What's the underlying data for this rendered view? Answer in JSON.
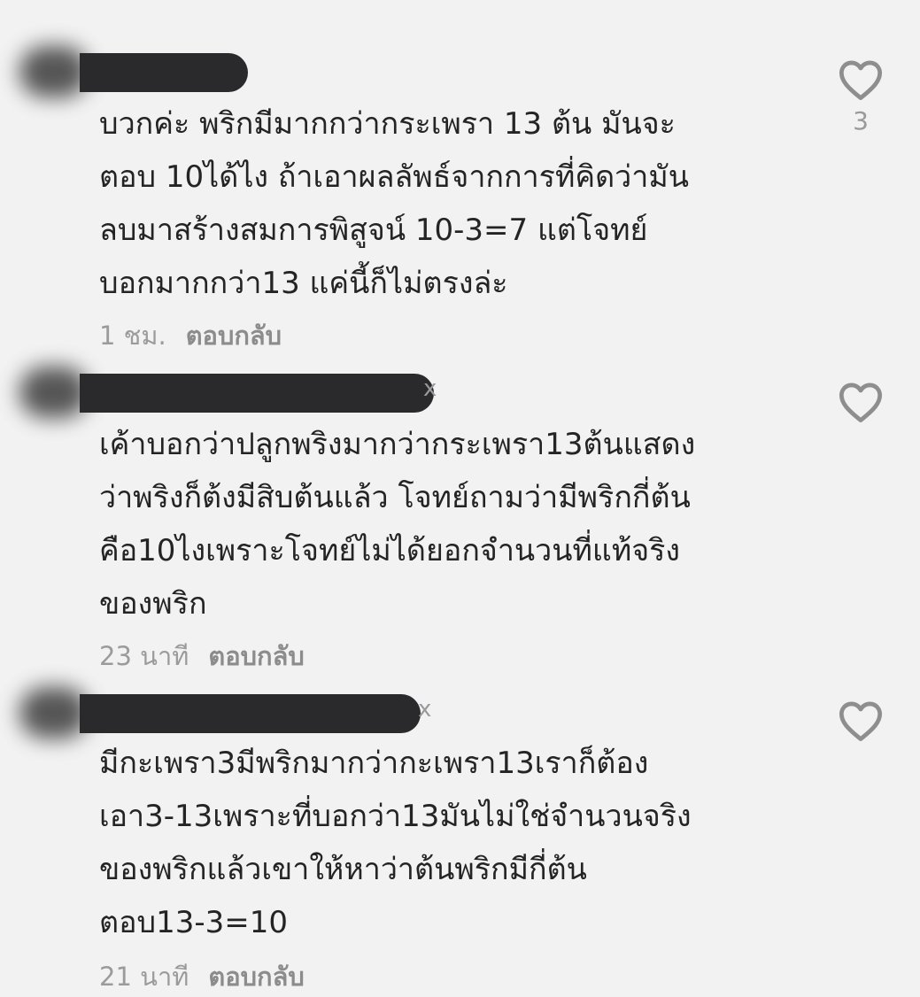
{
  "comments": [
    {
      "text": "บวกค่ะ พริกมีมากกว่ากระเพรา 13 ต้น มันจะ\nตอบ 10ได้ไง ถ้าเอาผลลัพธ์จากการที่คิดว่ามัน\nลบมาสร้างสมการพิสูจน์ 10-3=7 แต่โจทย์\nบอกมากกว่า13 แค่นี้ก็ไม่ตรงล่ะ",
      "time": "1 ชม.",
      "reply_label": "ตอบกลับ",
      "like_count": "3",
      "name_suffix": ""
    },
    {
      "text": "เค้าบอกว่าปลูกพริงมากว่ากระเพรา13ต้นแสดง\nว่าพริงก็ต้งมีสิบต้นแล้ว โจทย์ถามว่ามีพริกกี่ต้น\nคือ10ไงเพราะโจทย์ไม่ได้ยอกจำนวนที่แท้จริง\nของพริก",
      "time": "23 นาที",
      "reply_label": "ตอบกลับ",
      "like_count": "",
      "name_suffix": "x"
    },
    {
      "text": "มีกะเพรา3มีพริกมากว่ากะเพรา13เราก็ต้อง\nเอา3-13เพราะที่บอกว่า13มันไม่ใช่จำนวนจริง\nของพริกแล้วเขาให้หาว่าต้นพริกมีกี่ต้น\nตอบ13-3=10",
      "time": "21 นาที",
      "reply_label": "ตอบกลับ",
      "like_count": "",
      "name_suffix": "x"
    }
  ],
  "icons": {
    "like": "heart-outline-icon",
    "like_color": "#8e8e8e"
  }
}
